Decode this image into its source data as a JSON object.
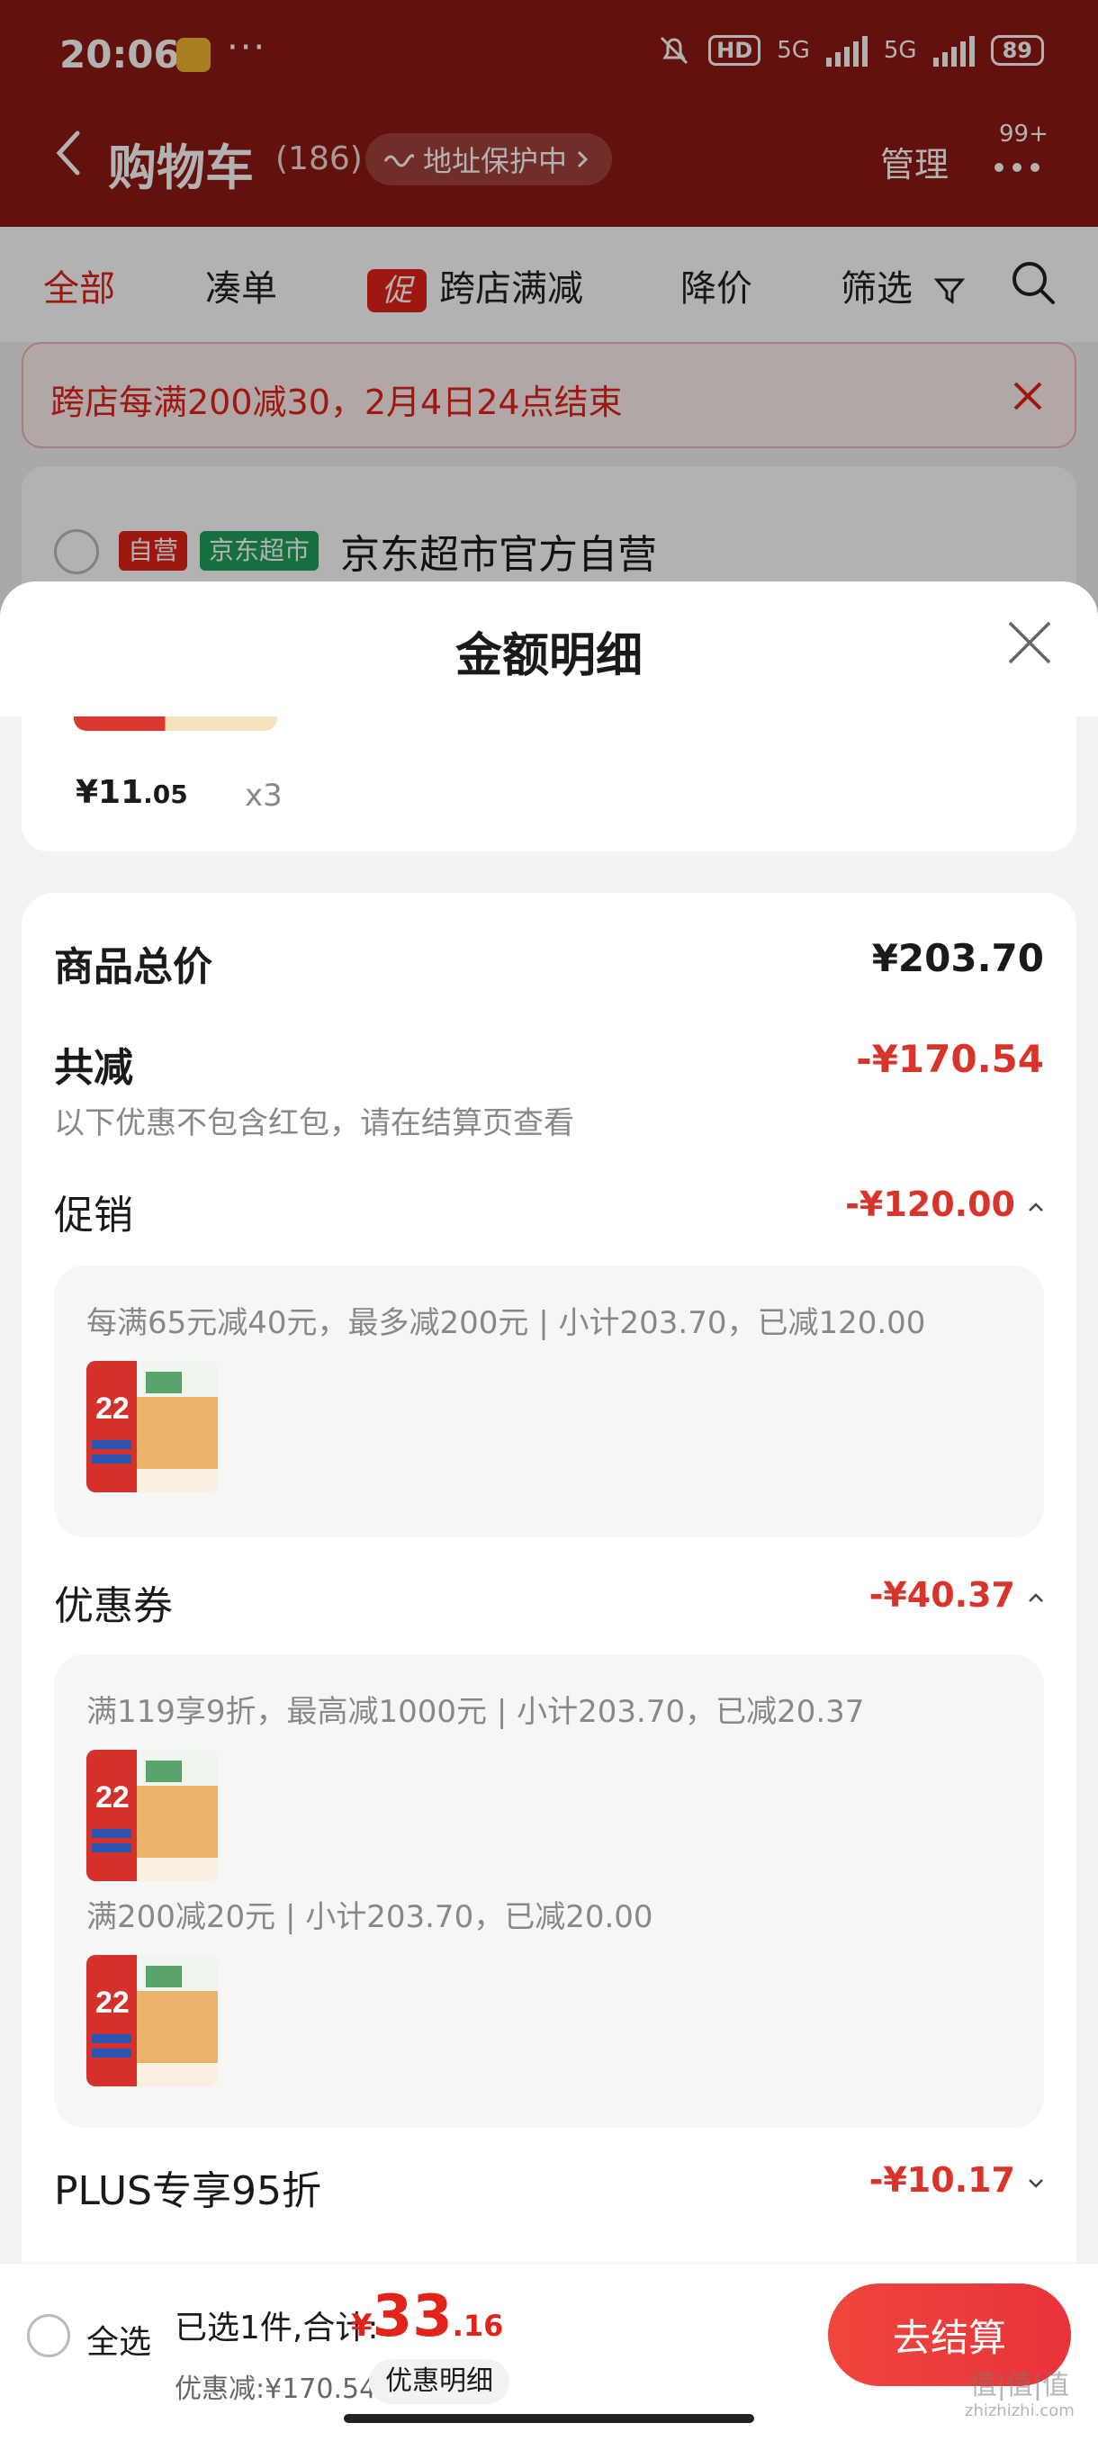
{
  "status_bar": {
    "time": "20:06",
    "dots": "···",
    "hd": "HD",
    "net1": "5G",
    "net2": "5G",
    "battery": "89"
  },
  "nav": {
    "title": "购物车",
    "count": "(186)",
    "address_pill": "地址保护中",
    "manage": "管理",
    "badge": "99+"
  },
  "tabs": [
    {
      "label": "全部",
      "active": true
    },
    {
      "label": "凑单"
    },
    {
      "label": "跨店满减",
      "tag": "促"
    },
    {
      "label": "降价"
    },
    {
      "label": "筛选"
    }
  ],
  "promo_banner": {
    "text": "跨店每满200减30，2月4日24点结束"
  },
  "store": {
    "tag_self": "自营",
    "tag_market": "京东超市",
    "name": "京东超市官方自营"
  },
  "sheet": {
    "title": "金额明细",
    "item": {
      "price_int": "¥11",
      "price_dec": ".05",
      "qty": "x3"
    },
    "total": {
      "label": "商品总价",
      "value": "¥203.70"
    },
    "discount": {
      "label": "共减",
      "value": "-¥170.54",
      "note": "以下优惠不包含红包，请在结算页查看"
    },
    "promotion": {
      "label": "促销",
      "value": "-¥120.00",
      "rule": "每满65元减40元，最多减200元 | 小计203.70，已减120.00"
    },
    "coupon": {
      "label": "优惠券",
      "value": "-¥40.37",
      "rules": [
        "满119享9折，最高减1000元 | 小计203.70，已减20.37",
        "满200减20元 | 小计203.70，已减20.00"
      ]
    },
    "plus": {
      "label": "PLUS专享95折",
      "value": "-¥10.17"
    }
  },
  "product_image": {
    "badge": "22",
    "alt": "product-thumbnail"
  },
  "bottom_bar": {
    "select_all": "全选",
    "selected_total_label": "已选1件,合计:",
    "total_currency": "¥",
    "total_int": "33",
    "total_dec": ".16",
    "discount_label": "优惠减:¥170.54",
    "detail_pill": "优惠明细",
    "checkout": "去结算"
  },
  "watermark": {
    "main": "值|值|值",
    "sub": "zhizhizhi.com"
  },
  "colors": {
    "brand_red": "#e2231a",
    "header_bg": "#8e1912",
    "price_red": "#d9342b"
  }
}
